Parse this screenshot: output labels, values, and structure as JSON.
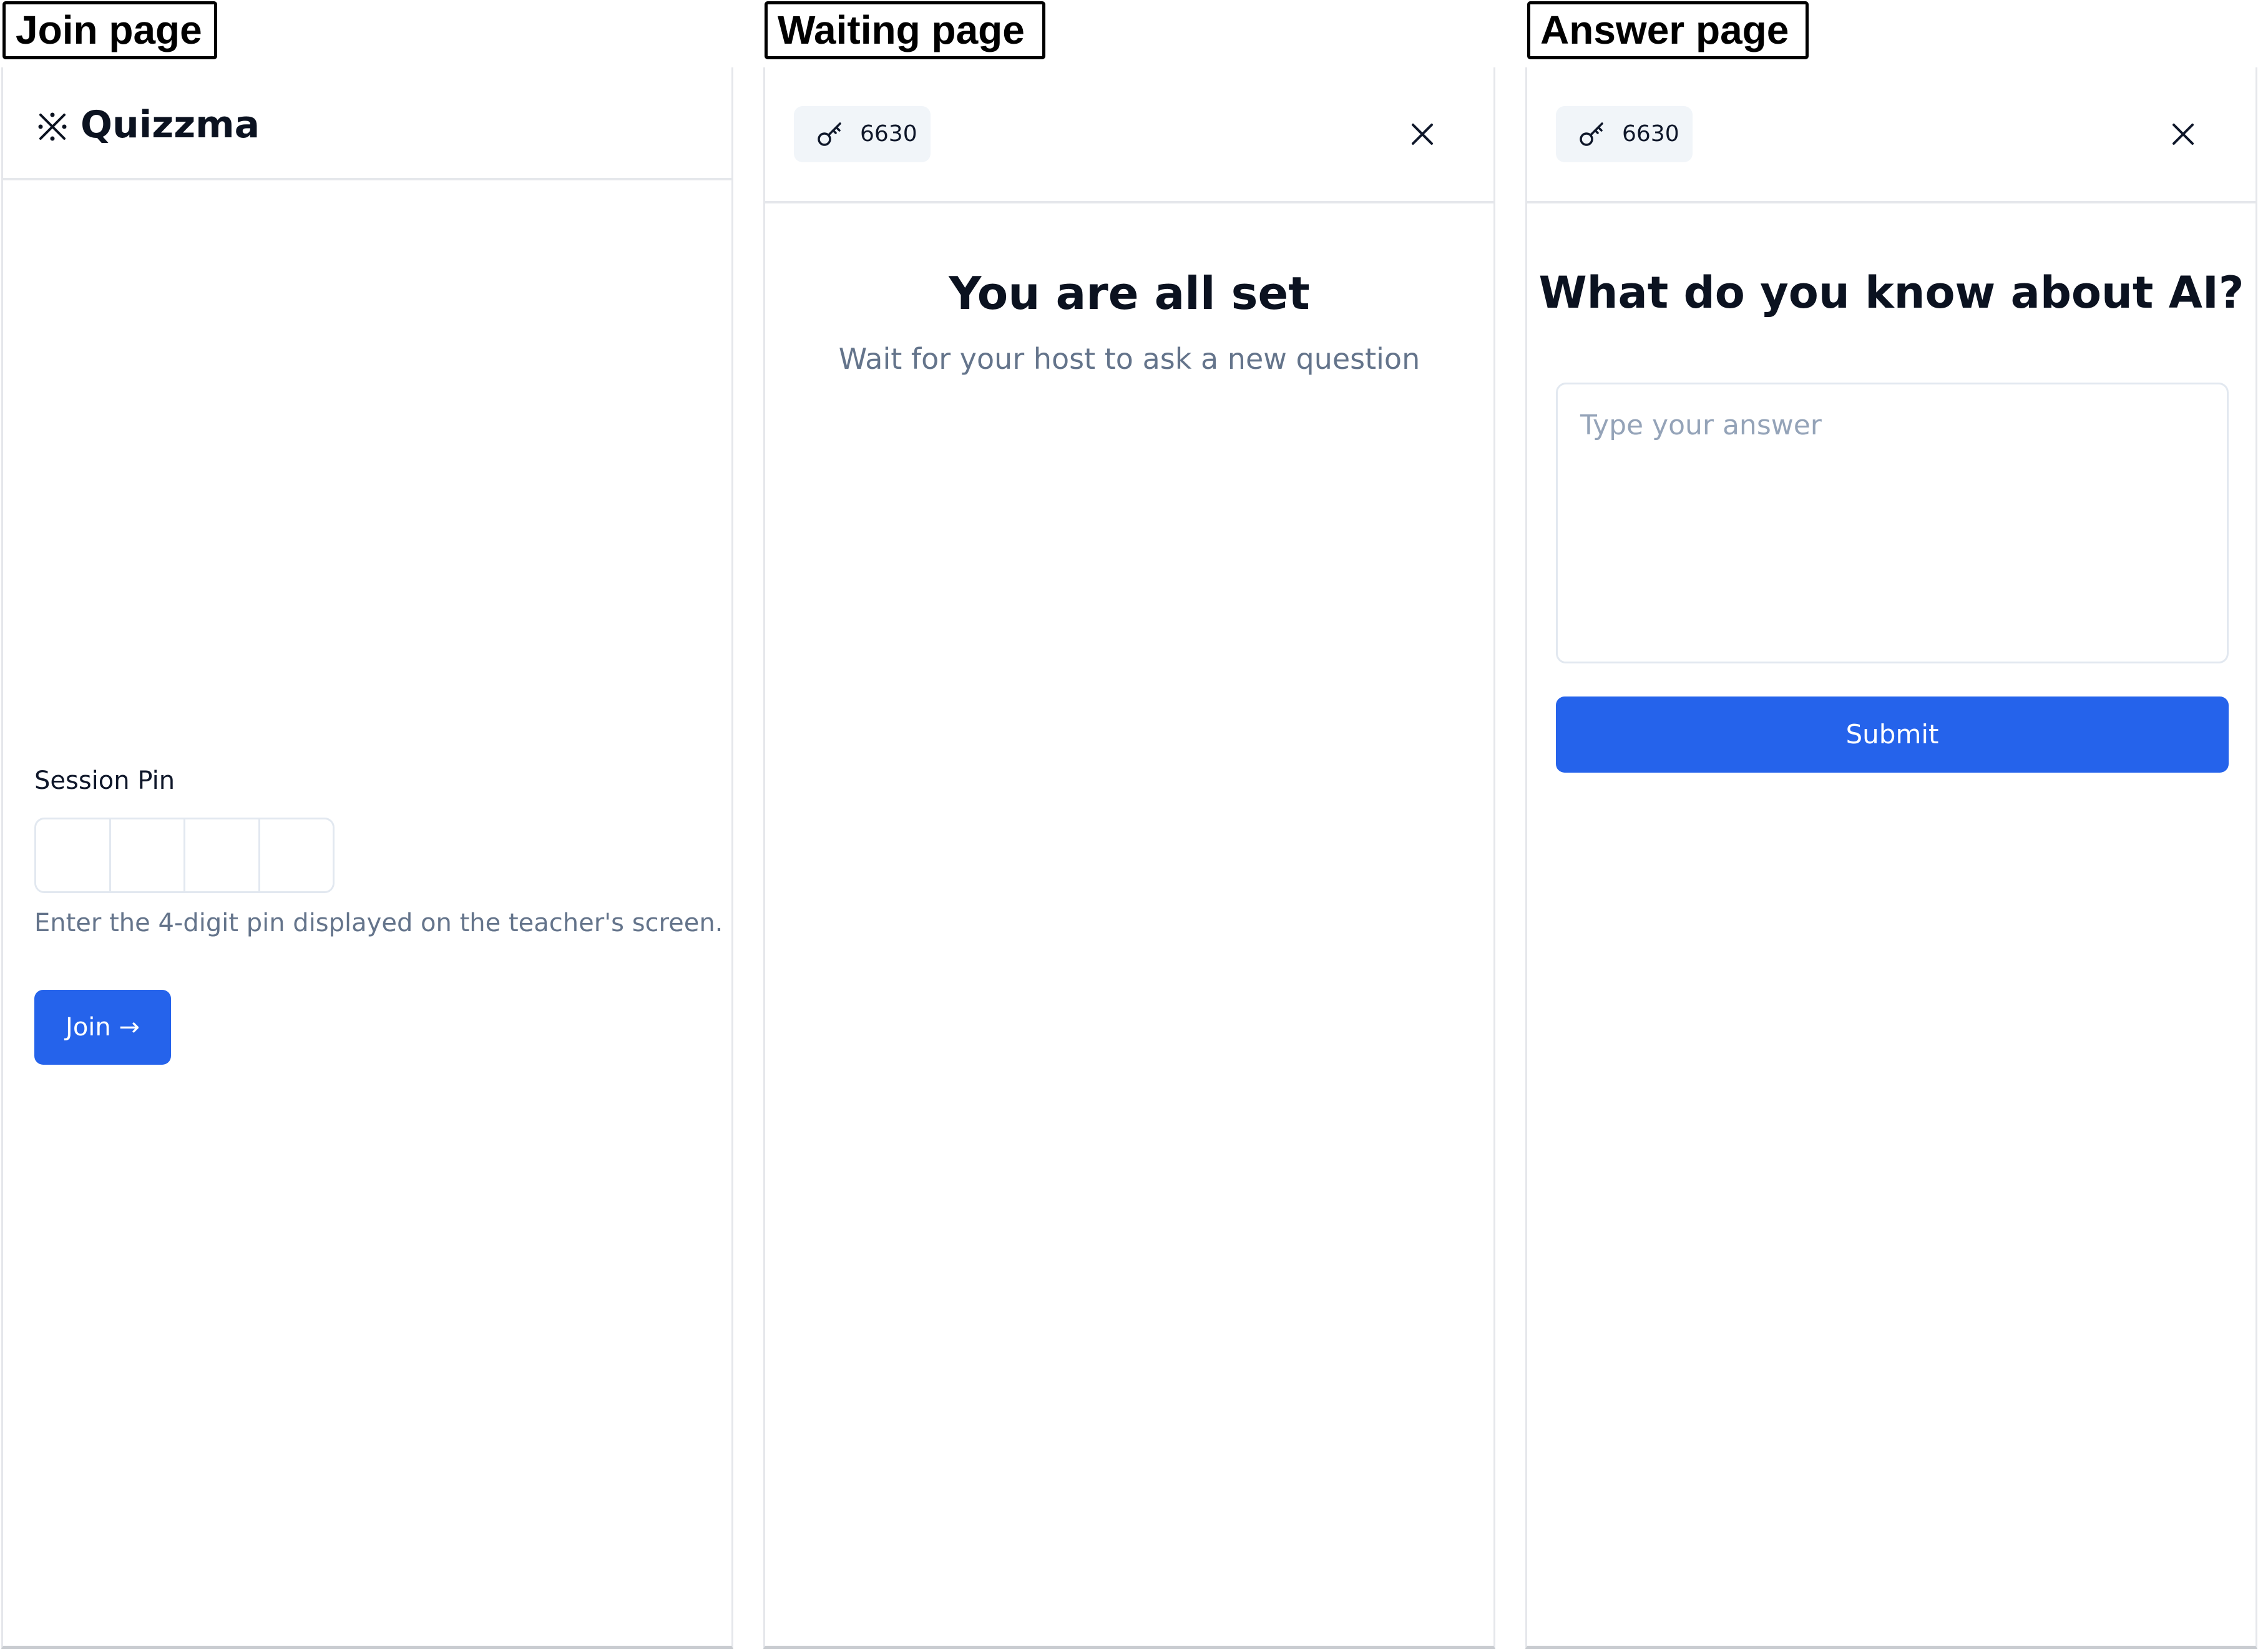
{
  "captions": {
    "join": "Join page",
    "waiting": "Waiting page",
    "answer": "Answer page"
  },
  "join_page": {
    "brand_icon": "reference-mark-icon",
    "brand_name": "Quizzma",
    "pin_label": "Session Pin",
    "pin_slots": [
      "",
      "",
      "",
      ""
    ],
    "helper_text": "Enter the 4-digit pin displayed on the teacher's screen.",
    "join_button": "Join →",
    "accent_color": "#2563eb"
  },
  "waiting_page": {
    "session_pin": "6630",
    "key_icon": "key-icon",
    "close_icon": "close-icon",
    "title": "You are all set",
    "subtitle": "Wait for your host to ask a new question"
  },
  "answer_page": {
    "session_pin": "6630",
    "key_icon": "key-icon",
    "close_icon": "close-icon",
    "question": "What do you know about AI?",
    "answer_placeholder": "Type your answer",
    "submit_button": "Submit",
    "accent_color": "#2563eb"
  }
}
